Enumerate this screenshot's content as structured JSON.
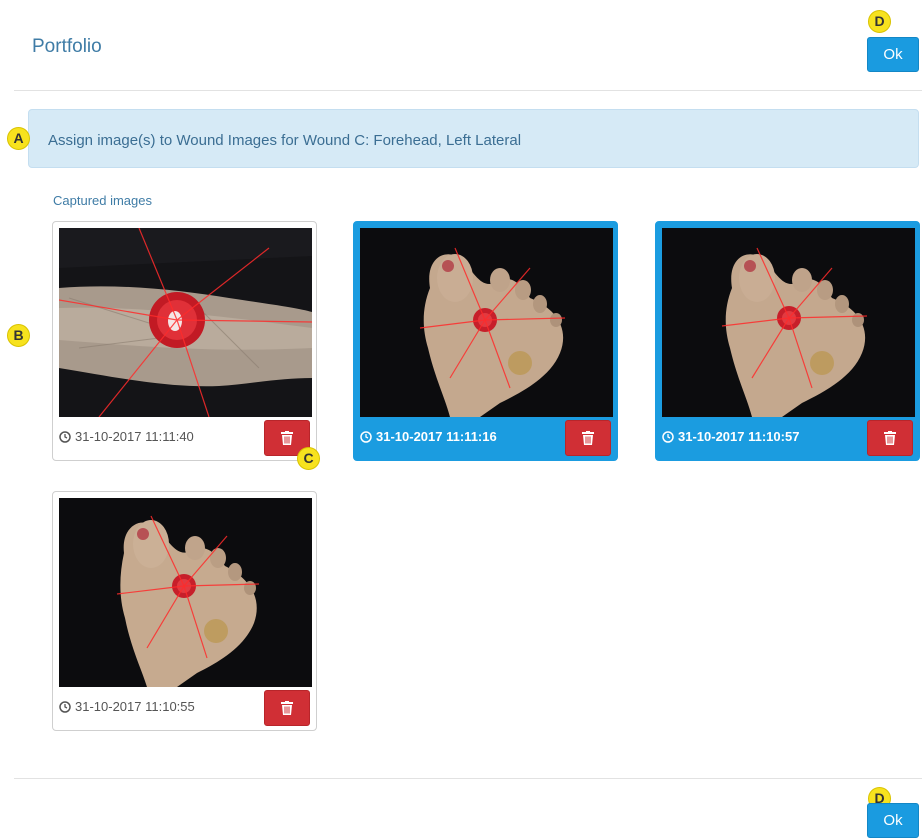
{
  "header": {
    "title": "Portfolio",
    "ok_label": "Ok"
  },
  "alert": {
    "text": "Assign image(s) to Wound Images for Wound C: Forehead, Left Lateral"
  },
  "section": {
    "label": "Captured images"
  },
  "images": [
    {
      "timestamp": "31-10-2017 11:11:40",
      "selected": false,
      "subject": "wound-closeup"
    },
    {
      "timestamp": "31-10-2017 11:11:16",
      "selected": true,
      "subject": "foot-sole"
    },
    {
      "timestamp": "31-10-2017 11:10:57",
      "selected": true,
      "subject": "foot-sole"
    },
    {
      "timestamp": "31-10-2017 11:10:55",
      "selected": false,
      "subject": "foot-sole"
    }
  ],
  "footer": {
    "ok_label": "Ok"
  },
  "markers": {
    "a": "A",
    "b": "B",
    "c": "C",
    "d_top": "D",
    "d_bottom": "D"
  },
  "icons": {
    "timestamp": "clock-icon",
    "delete": "trash-icon"
  },
  "colors": {
    "primary": "#1a9be0",
    "danger": "#d02f35",
    "alert_bg": "#d6eaf6",
    "marker": "#f7e21e"
  }
}
